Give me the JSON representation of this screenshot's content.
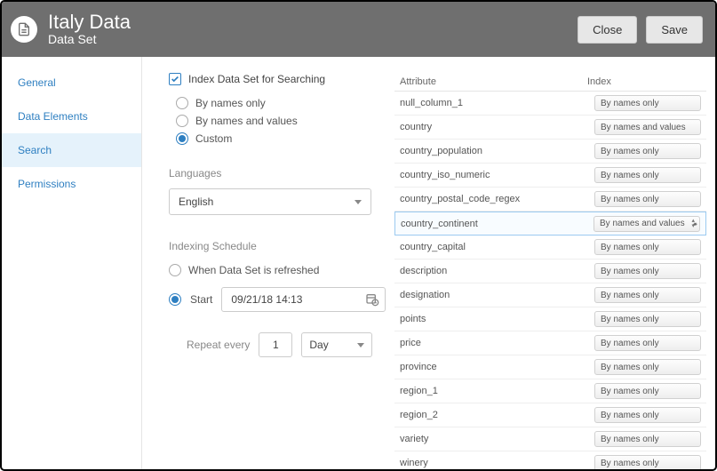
{
  "header": {
    "title": "Italy Data",
    "subtitle": "Data Set",
    "close_label": "Close",
    "save_label": "Save"
  },
  "sidebar": {
    "items": [
      {
        "label": "General"
      },
      {
        "label": "Data Elements"
      },
      {
        "label": "Search"
      },
      {
        "label": "Permissions"
      }
    ],
    "active_index": 2
  },
  "form": {
    "index_checkbox_label": "Index Data Set for Searching",
    "mode_options": {
      "names_only": "By names only",
      "names_values": "By names and values",
      "custom": "Custom"
    },
    "languages_label": "Languages",
    "language_value": "English",
    "schedule_label": "Indexing Schedule",
    "schedule_options": {
      "refreshed": "When Data Set is refreshed",
      "start": "Start"
    },
    "start_date": "09/21/18 14:13",
    "repeat_label": "Repeat every",
    "repeat_value": "1",
    "repeat_unit": "Day"
  },
  "table": {
    "headers": {
      "attribute": "Attribute",
      "index": "Index"
    },
    "rows": [
      {
        "attr": "null_column_1",
        "index": "By names only"
      },
      {
        "attr": "country",
        "index": "By names and values"
      },
      {
        "attr": "country_population",
        "index": "By names only"
      },
      {
        "attr": "country_iso_numeric",
        "index": "By names only"
      },
      {
        "attr": "country_postal_code_regex",
        "index": "By names only"
      },
      {
        "attr": "country_continent",
        "index": "By names and values",
        "selected": true
      },
      {
        "attr": "country_capital",
        "index": "By names only"
      },
      {
        "attr": "description",
        "index": "By names only"
      },
      {
        "attr": "designation",
        "index": "By names only"
      },
      {
        "attr": "points",
        "index": "By names only"
      },
      {
        "attr": "price",
        "index": "By names only"
      },
      {
        "attr": "province",
        "index": "By names only"
      },
      {
        "attr": "region_1",
        "index": "By names only"
      },
      {
        "attr": "region_2",
        "index": "By names only"
      },
      {
        "attr": "variety",
        "index": "By names only"
      },
      {
        "attr": "winery",
        "index": "By names only"
      }
    ]
  }
}
